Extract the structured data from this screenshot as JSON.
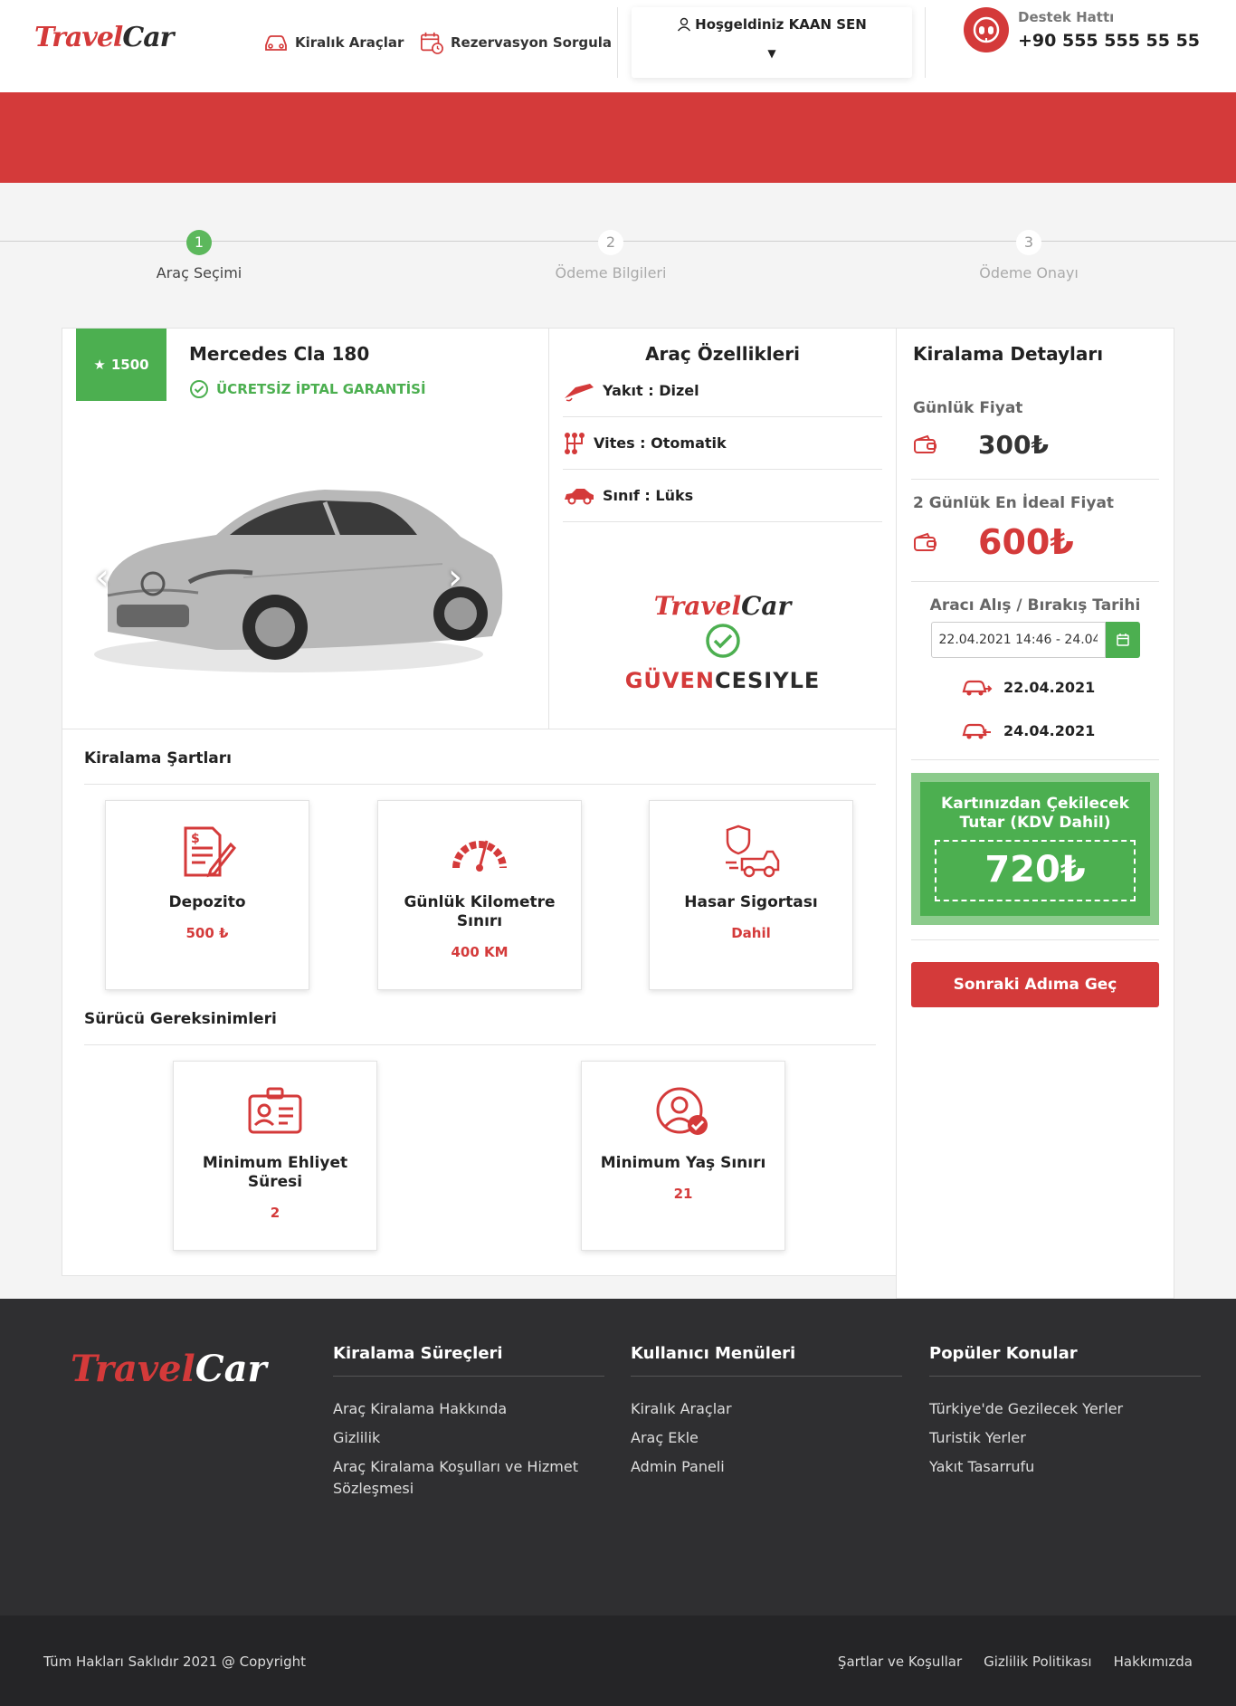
{
  "header": {
    "logo_part1": "Travel",
    "logo_part2": "Car",
    "nav_rental_cars": "Kiralık Araçlar",
    "nav_reservation": "Rezervasyon Sorgula",
    "greeting": "Hoşgeldiniz KAAN SEN",
    "support_label": "Destek Hattı",
    "support_phone": "+90 555 555 55 55"
  },
  "stepper": {
    "steps": [
      {
        "num": "1",
        "label": "Araç Seçimi",
        "active": true
      },
      {
        "num": "2",
        "label": "Ödeme Bilgileri",
        "active": false
      },
      {
        "num": "3",
        "label": "Ödeme Onayı",
        "active": false
      }
    ]
  },
  "car": {
    "rating": "1500",
    "title": "Mercedes Cla 180",
    "cancel_text": "ÜCRETSİZ İPTAL GARANTİSİ"
  },
  "features": {
    "title": "Araç Özellikleri",
    "fuel": "Yakıt : Dizel",
    "gear": "Vites : Otomatik",
    "class": "Sınıf : Lüks",
    "guarantee_logo1": "Travel",
    "guarantee_logo2": "Car",
    "guarantee_text1": "GÜVEN",
    "guarantee_text2": "CESIYLE"
  },
  "details": {
    "title": "Kiralama Detayları",
    "daily_label": "Günlük Fiyat",
    "daily_price": "300₺",
    "ideal_label": "2 Günlük En İdeal Fiyat",
    "ideal_price": "600₺",
    "date_label": "Aracı Alış / Bırakış Tarihi",
    "date_range": "22.04.2021 14:46 - 24.04.",
    "pickup_date": "22.04.2021",
    "return_date": "24.04.2021",
    "total_label": "Kartınızdan Çekilecek Tutar (KDV Dahil)",
    "total_value": "720₺",
    "next_button": "Sonraki Adıma Geç"
  },
  "terms": {
    "title": "Kiralama Şartları",
    "items": [
      {
        "title": "Depozito",
        "value": "500 ₺"
      },
      {
        "title": "Günlük Kilometre Sınırı",
        "value": "400 KM"
      },
      {
        "title": "Hasar Sigortası",
        "value": "Dahil"
      }
    ]
  },
  "driver": {
    "title": "Sürücü Gereksinimleri",
    "items": [
      {
        "title": "Minimum Ehliyet Süresi",
        "value": "2"
      },
      {
        "title": "Minimum Yaş Sınırı",
        "value": "21"
      }
    ]
  },
  "footer": {
    "logo_part1": "Travel",
    "logo_part2": "Car",
    "col1_title": "Kiralama Süreçleri",
    "col1_items": [
      "Araç Kiralama Hakkında",
      "Gizlilik",
      "Araç Kiralama Koşulları ve Hizmet Sözleşmesi"
    ],
    "col2_title": "Kullanıcı Menüleri",
    "col2_items": [
      "Kiralık Araçlar",
      "Araç Ekle",
      "Admin Paneli"
    ],
    "col3_title": "Popüler Konular",
    "col3_items": [
      "Türkiye'de Gezilecek Yerler",
      "Turistik Yerler",
      "Yakıt Tasarrufu"
    ],
    "copyright": "Tüm Hakları Saklıdır 2021 @ Copyright",
    "bottom_links": [
      "Şartlar ve Koşullar",
      "Gizlilik Politikası",
      "Hakkımızda"
    ]
  },
  "colors": {
    "brand_red": "#d43a3a",
    "success_green": "#4caf50",
    "footer_dark": "#2f2f31"
  }
}
